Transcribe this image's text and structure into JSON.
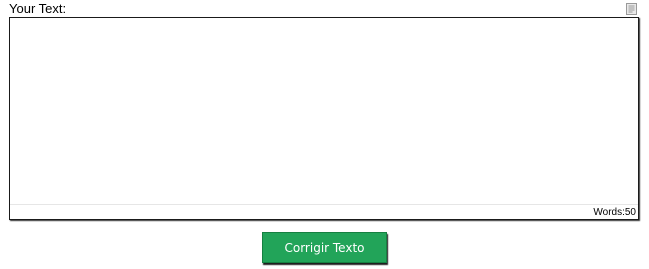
{
  "input_section": {
    "label": "Your Text:",
    "text_value": "",
    "copy_icon": "document-copy-icon"
  },
  "status": {
    "word_count_text": "Words:50"
  },
  "actions": {
    "submit_label": "Corrigir Texto"
  },
  "colors": {
    "button_background": "#22a459",
    "button_border": "#168041",
    "button_text": "#ffffff",
    "editor_border": "#1a1a1a",
    "icon_color": "#9a9a9a"
  }
}
